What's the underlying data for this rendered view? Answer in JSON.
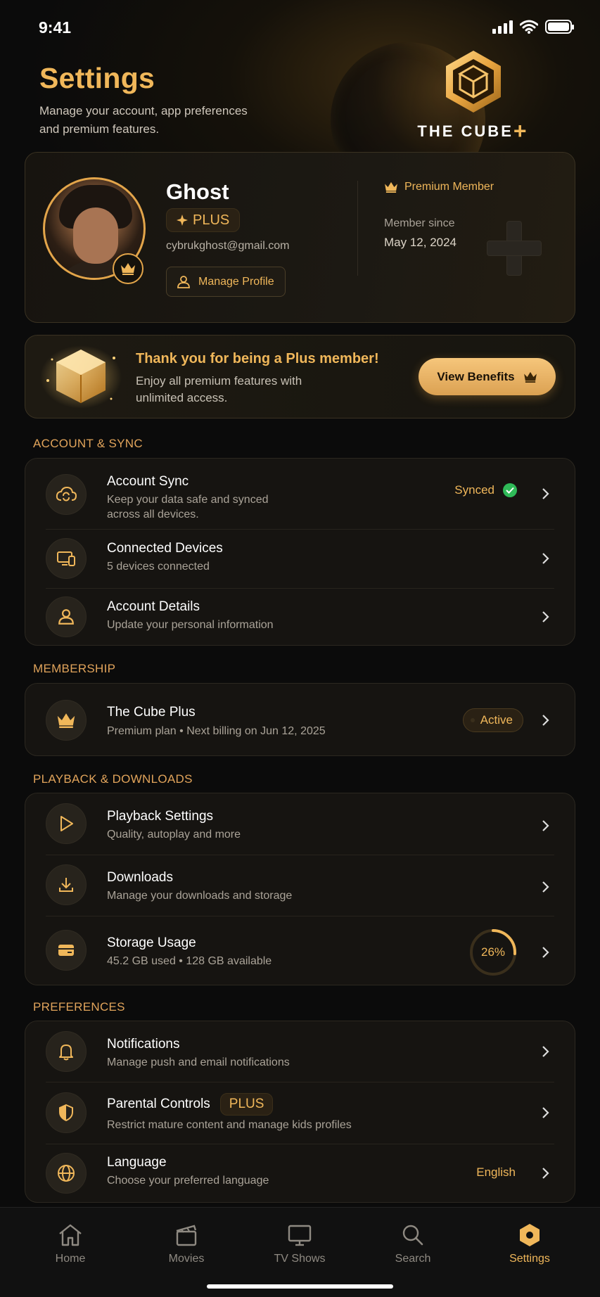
{
  "status_bar": {
    "time": "9:41"
  },
  "header": {
    "title": "Settings",
    "subtitle_line1": "Manage your account, app preferences",
    "subtitle_line2": "and premium features.",
    "logo_text": "THE CUBE",
    "logo_plus": "+"
  },
  "profile": {
    "name": "Ghost",
    "plan_badge": "PLUS",
    "email": "cybrukghost@gmail.com",
    "manage_button": "Manage Profile",
    "premium_label": "Premium Member",
    "member_since_label": "Member since",
    "member_since_date": "May 12, 2024"
  },
  "promo": {
    "title": "Thank you for being a Plus member!",
    "text": "Enjoy all premium features with unlimited access.",
    "button": "View Benefits"
  },
  "sections": {
    "account": {
      "label": "ACCOUNT & SYNC",
      "items": [
        {
          "title": "Account Sync",
          "subtitle_line1": "Keep your data safe and synced",
          "subtitle_line2": "across all devices.",
          "status": "Synced"
        },
        {
          "title": "Connected Devices",
          "subtitle": "5 devices connected"
        },
        {
          "title": "Account Details",
          "subtitle": "Update your personal information"
        }
      ]
    },
    "membership": {
      "label": "MEMBERSHIP",
      "items": [
        {
          "title": "The Cube Plus",
          "subtitle": "Premium plan • Next billing on Jun 12, 2025",
          "status": "Active"
        }
      ]
    },
    "playback": {
      "label": "PLAYBACK & DOWNLOADS",
      "items": [
        {
          "title": "Playback Settings",
          "subtitle": "Quality, autoplay and more"
        },
        {
          "title": "Downloads",
          "subtitle": "Manage your downloads and storage"
        },
        {
          "title": "Storage Usage",
          "subtitle": "45.2 GB used • 128 GB available",
          "percent_label": "26%",
          "percent": 26
        }
      ]
    },
    "preferences": {
      "label": "PREFERENCES",
      "items": [
        {
          "title": "Notifications",
          "subtitle": "Manage push and email notifications"
        },
        {
          "title": "Parental Controls",
          "badge": "PLUS",
          "subtitle": "Restrict mature content and manage kids profiles"
        },
        {
          "title": "Language",
          "subtitle": "Choose your preferred language",
          "value": "English"
        }
      ]
    }
  },
  "tab_bar": {
    "tabs": [
      {
        "label": "Home",
        "icon": "home-icon"
      },
      {
        "label": "Movies",
        "icon": "clapperboard-icon"
      },
      {
        "label": "TV Shows",
        "icon": "tv-icon"
      },
      {
        "label": "Search",
        "icon": "search-icon"
      },
      {
        "label": "Settings",
        "icon": "settings-hex-icon",
        "active": true
      }
    ]
  },
  "colors": {
    "accent": "#f0b75a",
    "background": "#0b0b0b",
    "success": "#2fba58"
  }
}
